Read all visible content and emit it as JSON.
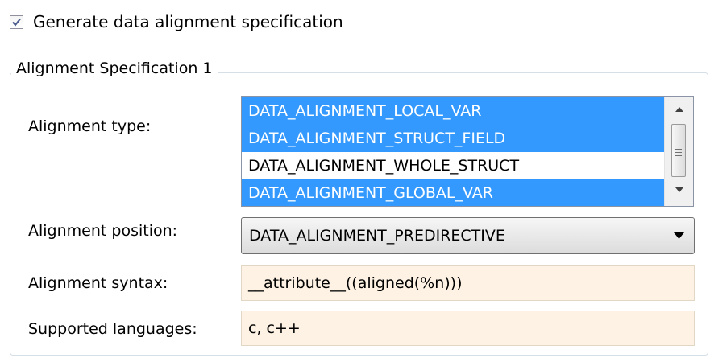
{
  "generate_checkbox": {
    "label": "Generate data alignment specification",
    "checked": true
  },
  "group": {
    "title": "Alignment Specification 1"
  },
  "alignment_type": {
    "label": "Alignment type:",
    "options": [
      {
        "text": "DATA_ALIGNMENT_LOCAL_VAR",
        "selected": true
      },
      {
        "text": "DATA_ALIGNMENT_STRUCT_FIELD",
        "selected": true
      },
      {
        "text": "DATA_ALIGNMENT_WHOLE_STRUCT",
        "selected": false
      },
      {
        "text": "DATA_ALIGNMENT_GLOBAL_VAR",
        "selected": true
      }
    ]
  },
  "alignment_position": {
    "label": "Alignment position:",
    "value": "DATA_ALIGNMENT_PREDIRECTIVE"
  },
  "alignment_syntax": {
    "label": "Alignment syntax:",
    "value": "__attribute__((aligned(%n)))"
  },
  "supported_languages": {
    "label": "Supported languages:",
    "value": "c, c++"
  },
  "colors": {
    "selection": "#3399ff",
    "field_background": "#fdf2e3"
  }
}
